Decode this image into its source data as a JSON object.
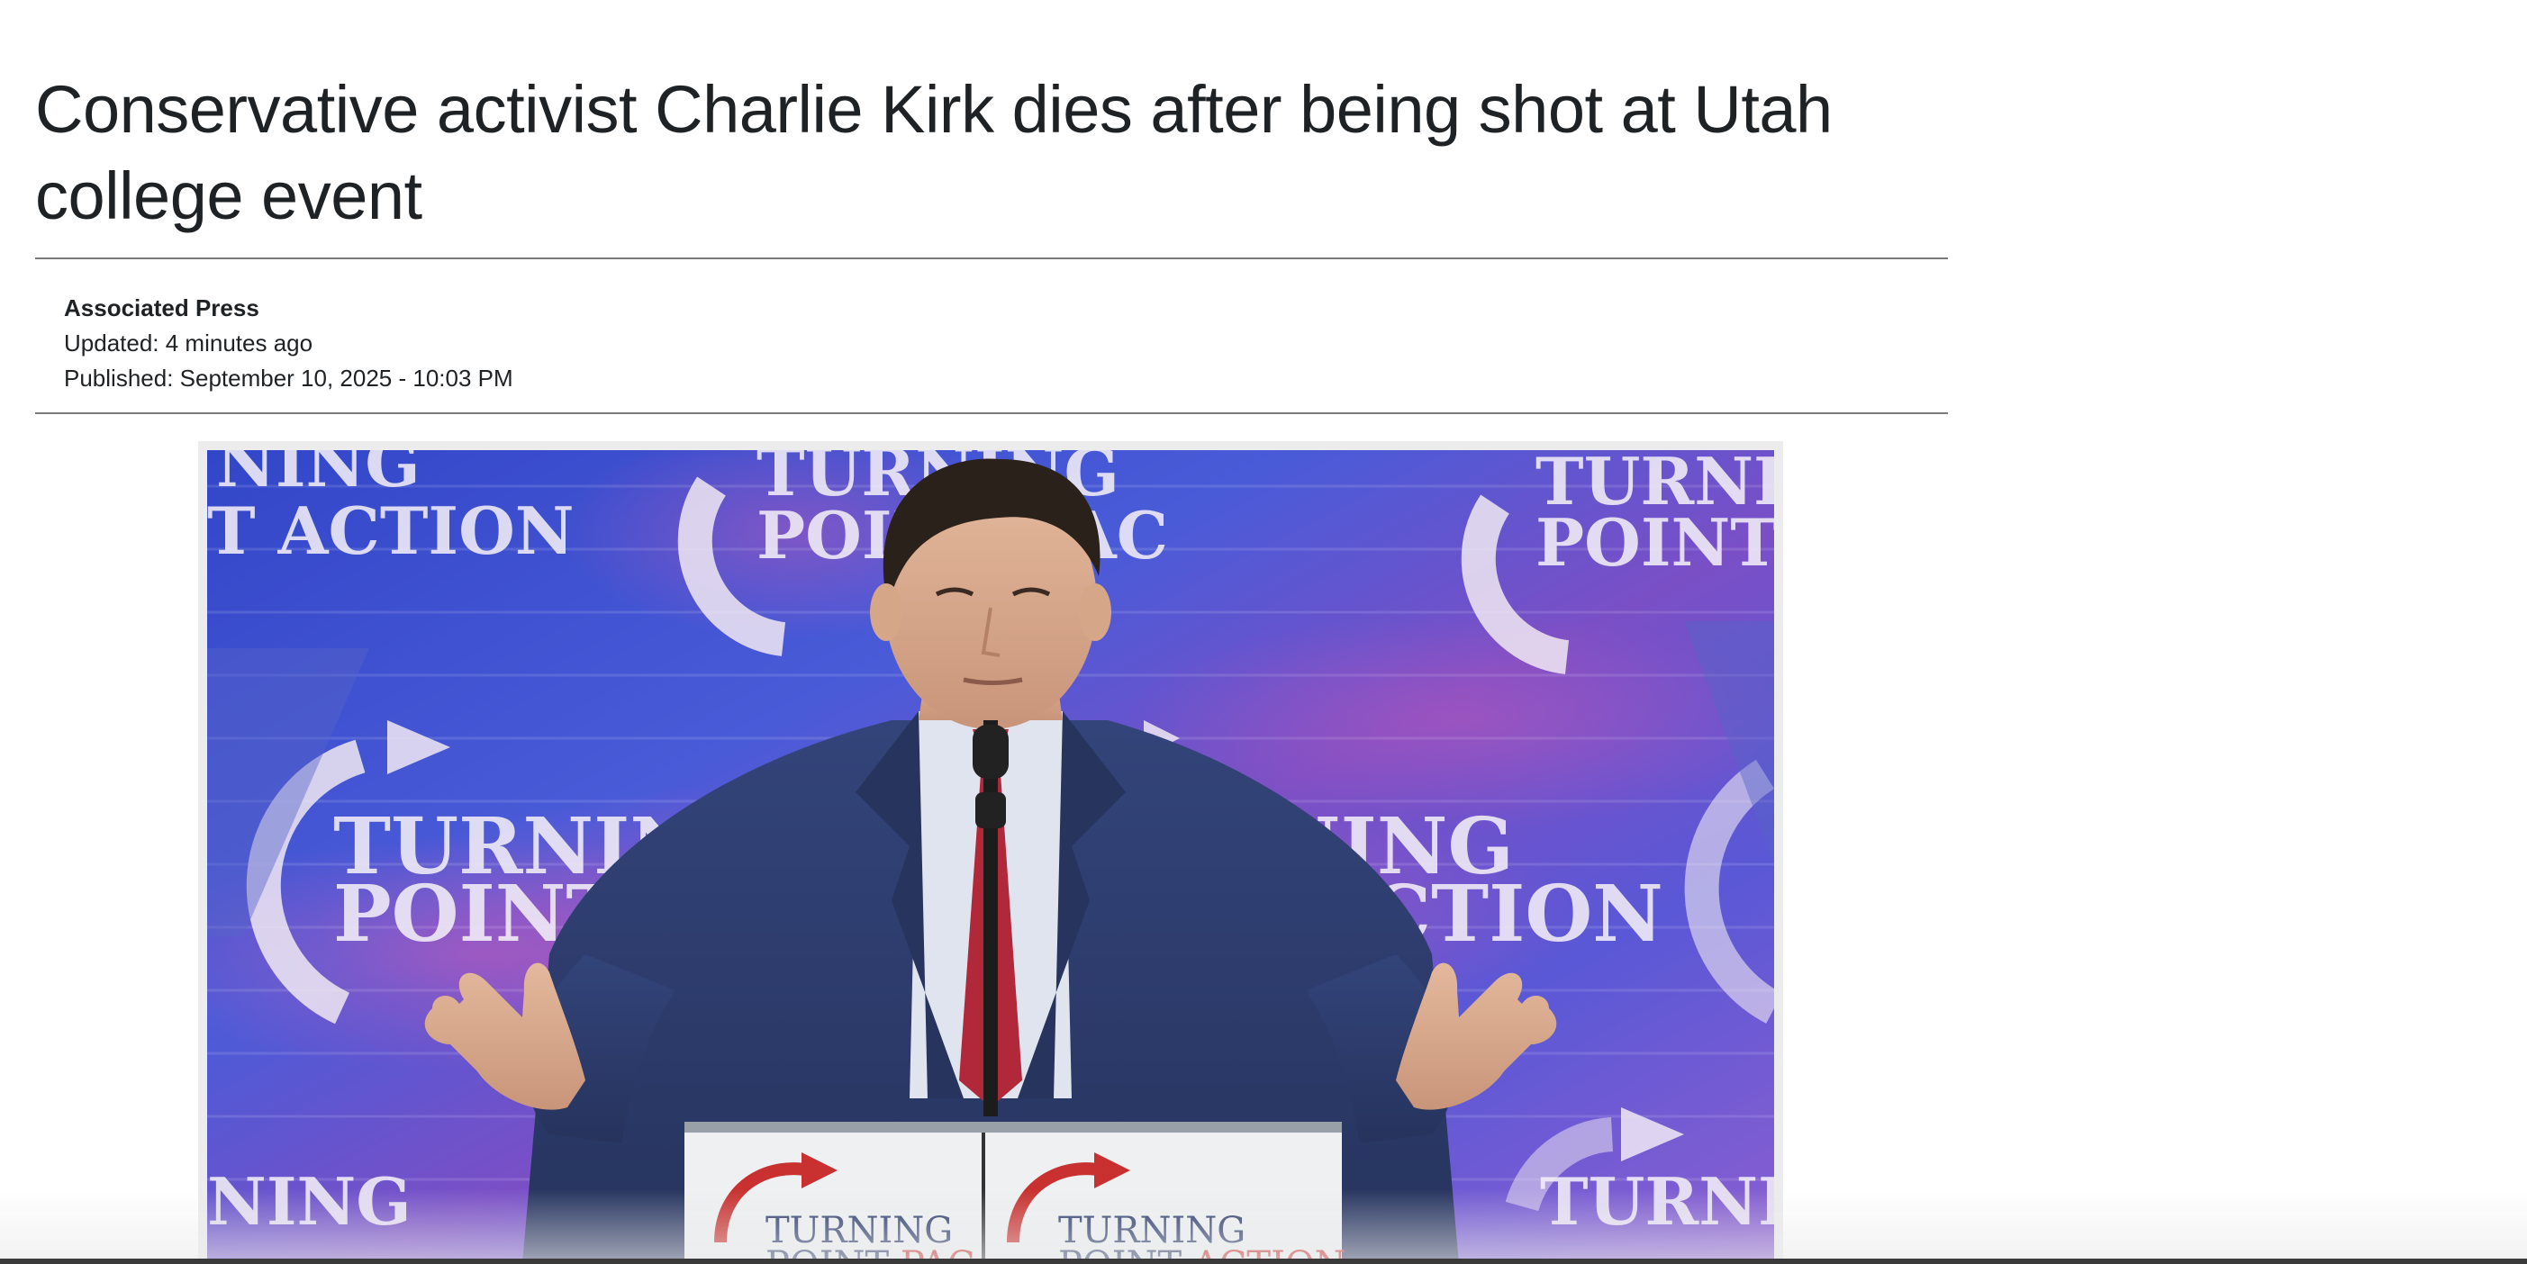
{
  "article": {
    "headline": "Conservative activist Charlie Kirk dies after being shot at Utah college event",
    "source": "Associated Press",
    "updated": "Updated: 4 minutes ago",
    "published": "Published: September 10, 2025 - 10:03 PM"
  },
  "photo": {
    "backdrop_texts": {
      "t1": "NING",
      "t2": "T ACTION",
      "t3": "TURNING",
      "t4": "POINT PAC",
      "t5": "TURNI",
      "t6": "POINT",
      "t7": "TURNING",
      "t8": "POINT PAC",
      "t9": "NING",
      "t10": "T ACTION",
      "t11": "NING",
      "t12": "TURNI"
    },
    "podium": {
      "left_line1": "TURNING",
      "left_line2a": "POINT ",
      "left_line2b": "PAC",
      "right_line1": "TURNING",
      "right_line2a": "POINT ",
      "right_line2b": "ACTION"
    },
    "colors": {
      "backdrop_blue": "#3b4fd0",
      "backdrop_pink": "#c24fb6",
      "suit": "#2d3a66",
      "tie": "#b0283a",
      "brand_red": "#c8312f"
    }
  }
}
